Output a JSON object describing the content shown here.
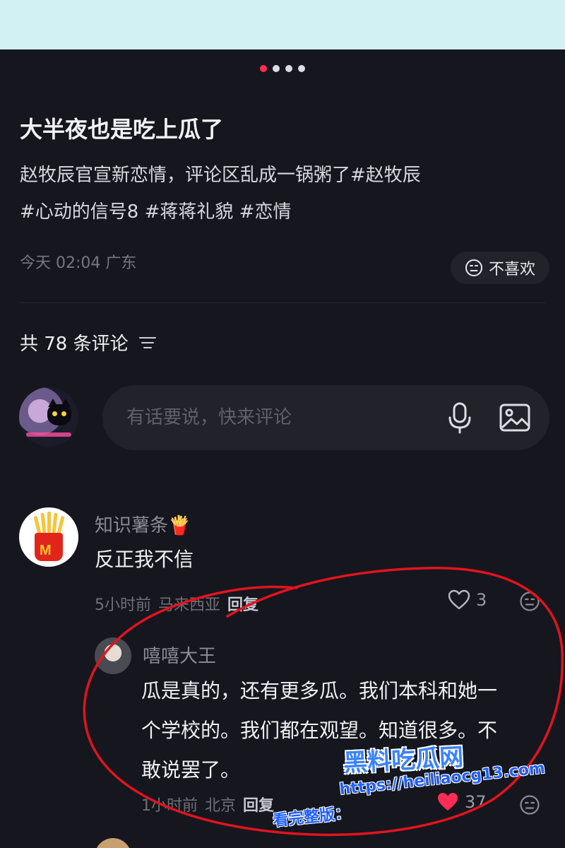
{
  "post": {
    "title": "大半夜也是吃上瓜了",
    "desc_text": "赵牧辰官宣新恋情，评论区乱成一锅粥了",
    "tags": [
      "#赵牧辰",
      "#心动的信号8",
      "#蒋蒋礼貌",
      "#恋情"
    ],
    "time": "今天 02:04",
    "location": "广东",
    "dislike_label": "不喜欢",
    "dislike_icon": "neutral-face-icon"
  },
  "carousel": {
    "total": 4,
    "active": 1
  },
  "comments_header": {
    "label": "共 78 条评论",
    "sort_icon": "sort-lines-icon"
  },
  "composer": {
    "placeholder": "有话要说，快来评论",
    "mic_icon": "microphone-icon",
    "image_icon": "image-icon"
  },
  "comments": [
    {
      "username": "知识薯条🍟",
      "text": "反正我不信",
      "time": "5小时前",
      "location": "马来西亚",
      "reply_label": "回复",
      "likes": "3",
      "replies": [
        {
          "username": "嘻嘻大王",
          "text_line1": "瓜是真的，还有更多瓜。我们本科和她一",
          "text_line2": "个学校的。我们都在观望。知道很多。不",
          "text_line3": "敢说罢了。",
          "time": "1小时前",
          "location": "北京",
          "reply_label": "回复",
          "likes": "37"
        }
      ]
    }
  ],
  "watermark": {
    "logo": "黑料吃瓜网",
    "label": "看完整版：",
    "url": "https://heiliaocg13.com"
  },
  "colors": {
    "background": "#16161e",
    "top_strip": "#d2f1f3",
    "accent_dot": "#ff2d55",
    "annotation_red": "#e0141e",
    "like_red": "#ff2d55"
  }
}
